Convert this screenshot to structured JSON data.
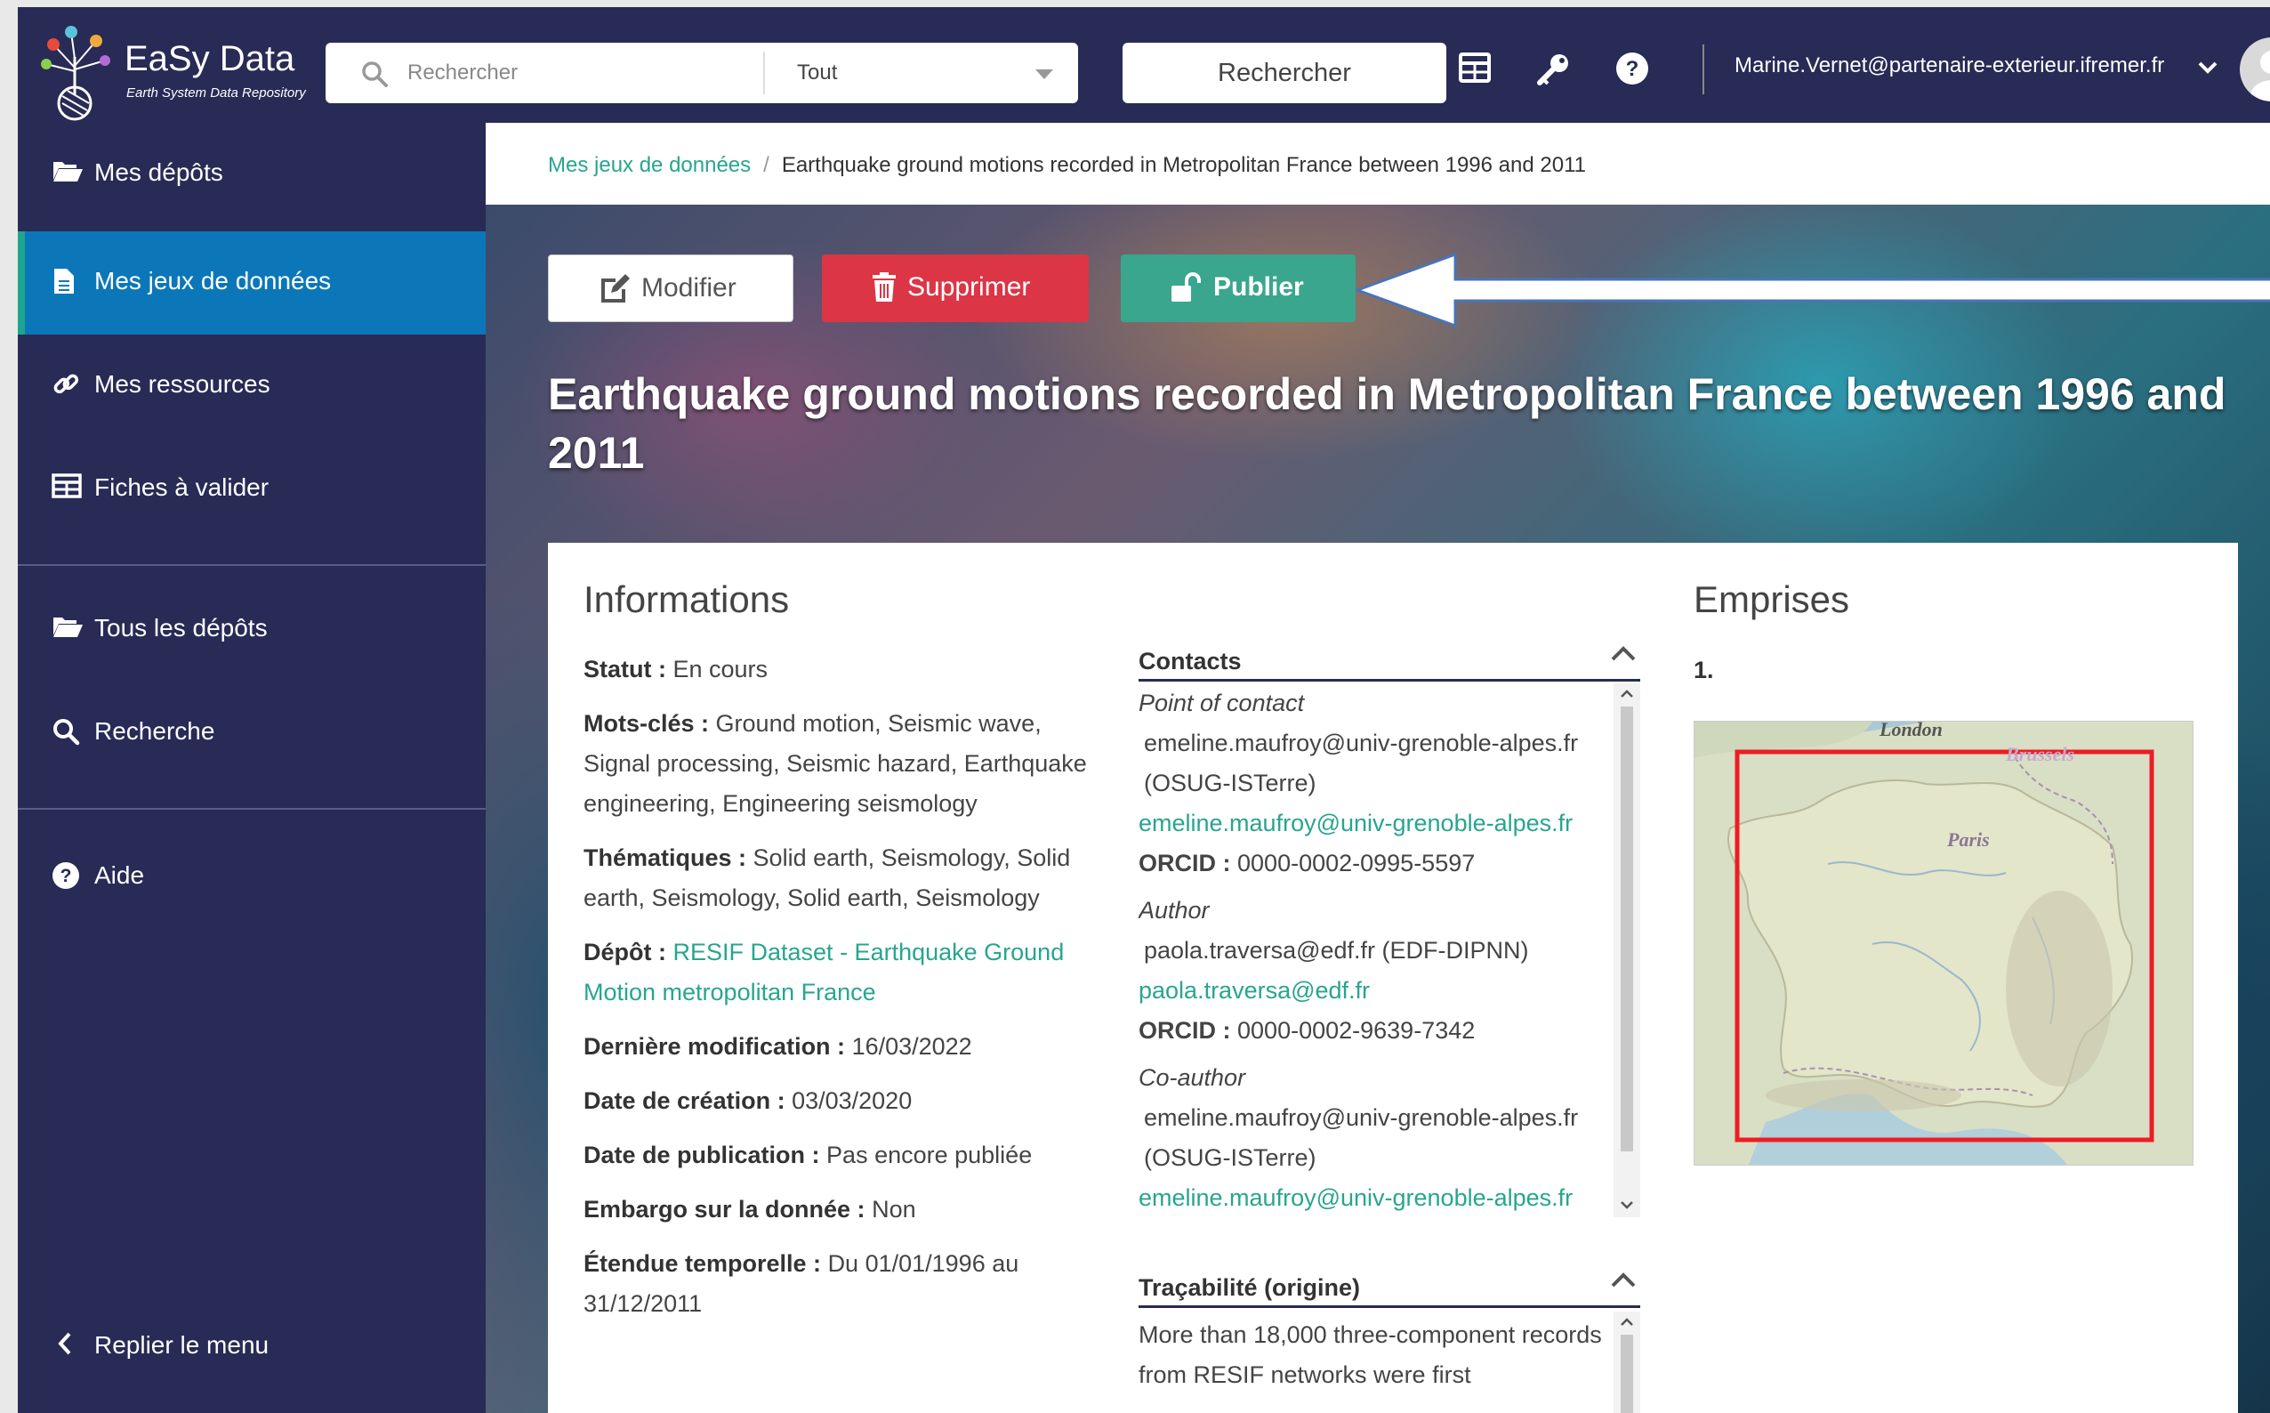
{
  "app": {
    "name": "EaSy Data",
    "subtitle": "Earth System Data Repository"
  },
  "header": {
    "search_placeholder": "Rechercher",
    "scope_value": "Tout",
    "search_button": "Rechercher",
    "user_email": "Marine.Vernet@partenaire-exterieur.ifremer.fr",
    "icons": [
      "grid-icon",
      "key-icon",
      "help-icon"
    ]
  },
  "sidebar": {
    "items": [
      {
        "label": "Mes dépôts",
        "icon": "folder-open-icon",
        "active": false
      },
      {
        "label": "Mes jeux de données",
        "icon": "file-icon",
        "active": true
      },
      {
        "label": "Mes ressources",
        "icon": "link-icon",
        "active": false
      },
      {
        "label": "Fiches à valider",
        "icon": "table-icon",
        "active": false
      },
      {
        "label": "Tous les dépôts",
        "icon": "folder-open-icon",
        "active": false
      },
      {
        "label": "Recherche",
        "icon": "search-icon",
        "active": false
      },
      {
        "label": "Aide",
        "icon": "help-icon",
        "active": false
      }
    ],
    "collapse_label": "Replier le menu"
  },
  "breadcrumb": {
    "parent": "Mes jeux de données",
    "separator": "/",
    "current": "Earthquake ground motions recorded in Metropolitan France between 1996 and 2011"
  },
  "actions": {
    "edit": "Modifier",
    "delete": "Supprimer",
    "publish": "Publier"
  },
  "dataset": {
    "title": "Earthquake ground motions recorded in Metropolitan France between 1996 and 2011"
  },
  "informations": {
    "title": "Informations",
    "statut_label": "Statut :",
    "statut_value": "En cours",
    "mots_label": "Mots-clés :",
    "mots_value": "Ground motion, Seismic wave, Signal processing, Seismic hazard, Earthquake engineering, Engineering seismology",
    "themes_label": "Thématiques :",
    "themes_value": "Solid earth, Seismology, Solid earth, Seismology, Solid earth, Seismology",
    "depot_label": "Dépôt :",
    "depot_value": "RESIF Dataset - Earthquake Ground Motion metropolitan France",
    "modif_label": "Dernière modification :",
    "modif_value": "16/03/2022",
    "creation_label": "Date de création :",
    "creation_value": "03/03/2020",
    "publication_label": "Date de publication :",
    "publication_value": "Pas encore publiée",
    "embargo_label": "Embargo sur la donnée :",
    "embargo_value": "Non",
    "etendue_label": "Étendue temporelle :",
    "etendue_value": "Du 01/01/1996 au 31/12/2011"
  },
  "contacts": {
    "title": "Contacts",
    "orcid_label": "ORCID :",
    "entries": [
      {
        "role": "Point of contact",
        "who": "emeline.maufroy@univ-grenoble-alpes.fr (OSUG-ISTerre)",
        "email": "emeline.maufroy@univ-grenoble-alpes.fr",
        "orcid": "0000-0002-0995-5597"
      },
      {
        "role": "Author",
        "who": "paola.traversa@edf.fr (EDF-DIPNN)",
        "email": "paola.traversa@edf.fr",
        "orcid": "0000-0002-9639-7342"
      },
      {
        "role": "Co-author",
        "who": "emeline.maufroy@univ-grenoble-alpes.fr (OSUG-ISTerre)",
        "email": "emeline.maufroy@univ-grenoble-alpes.fr"
      }
    ]
  },
  "traceability": {
    "title": "Traçabilité (origine)",
    "text": "More than 18,000 three-component records from RESIF networks were first"
  },
  "emprises": {
    "title": "Emprises",
    "item_number": "1.",
    "map_labels": [
      "London",
      "Brussels",
      "Paris"
    ]
  },
  "colors": {
    "navy": "#272b55",
    "active": "#0b77b9",
    "teal": "#28a58f",
    "red": "#dc3546",
    "publish": "#3aa68e"
  }
}
